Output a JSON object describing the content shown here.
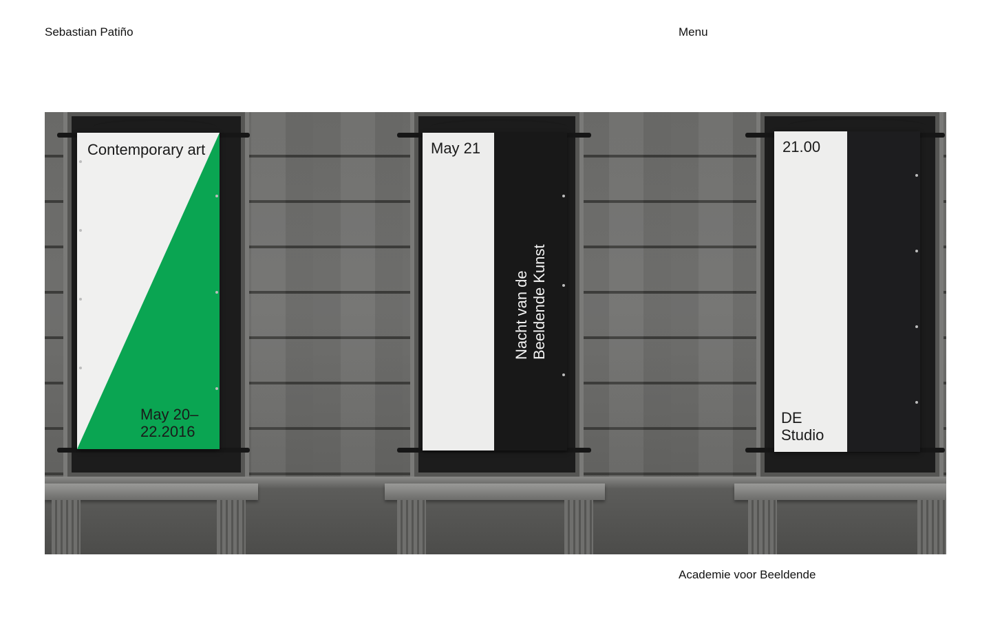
{
  "header": {
    "site_name": "Sebastian Patiño",
    "menu_label": "Menu"
  },
  "hero": {
    "caption": "Academie voor Beeldende",
    "banners": [
      {
        "top_text": "Contemporary art",
        "bottom_text": "May 20–22.2016",
        "accent": "#0aa552"
      },
      {
        "top_text": "May 21",
        "vertical_text": "Nacht van de Beeldende Kunst",
        "accent": "#181818"
      },
      {
        "top_text": "21.00",
        "bottom_text": "DE Studio",
        "accent": "#1d1d1f"
      }
    ]
  }
}
